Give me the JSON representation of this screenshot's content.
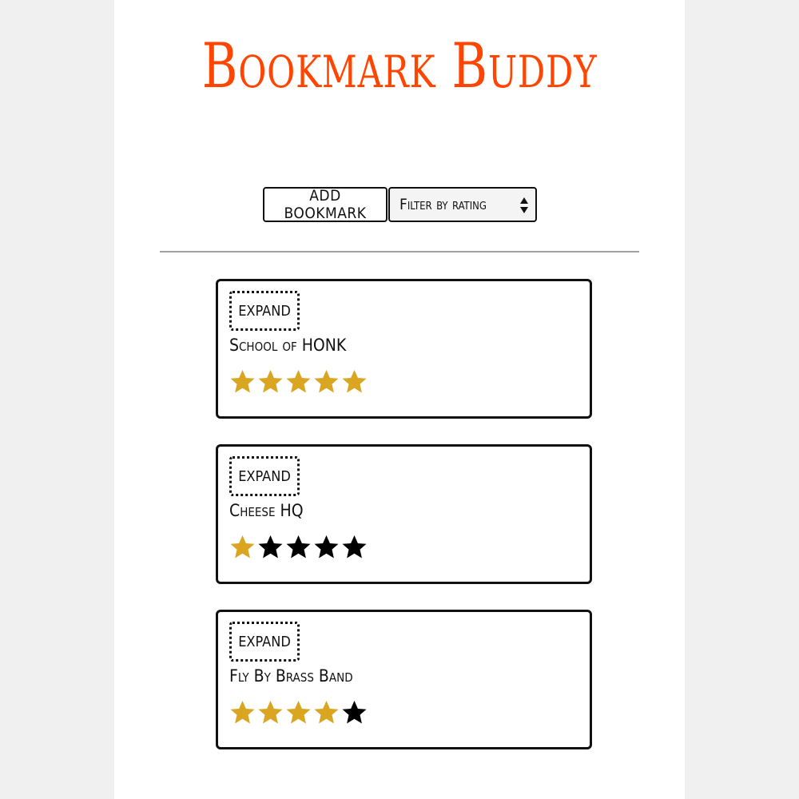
{
  "app": {
    "title": "Bookmark Buddy"
  },
  "toolbar": {
    "add_label": "ADD BOOKMARK",
    "filter_label": "Filter by rating"
  },
  "colors": {
    "title": "#ff4500",
    "star_on": "#daa520",
    "star_off": "#000000"
  },
  "bookmarks": [
    {
      "expand_label": "EXPAND",
      "title": "School of HONK",
      "rating": 5
    },
    {
      "expand_label": "EXPAND",
      "title": "Cheese HQ",
      "rating": 1
    },
    {
      "expand_label": "EXPAND",
      "title": "Fly By Brass Band",
      "rating": 4
    }
  ],
  "max_rating": 5
}
